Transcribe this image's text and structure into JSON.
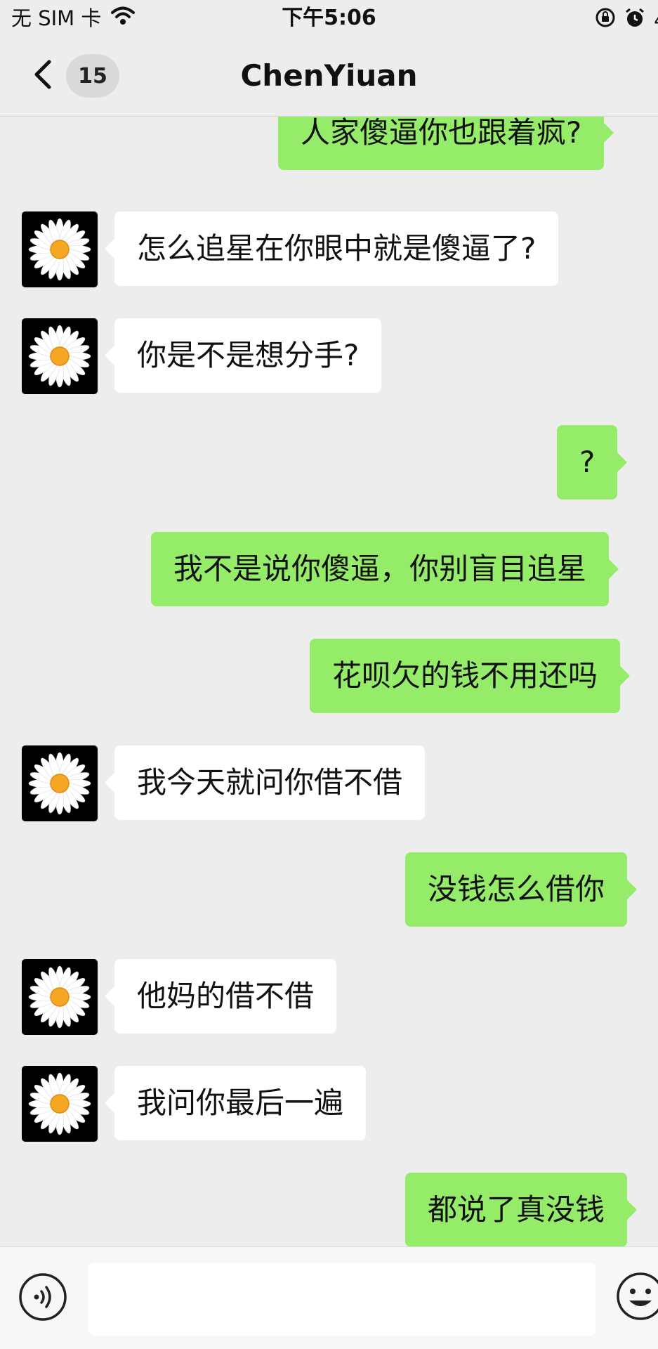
{
  "status_bar": {
    "carrier": "无 SIM 卡",
    "time": "下午5:06",
    "battery_partial": "4"
  },
  "nav": {
    "unread_count": "15",
    "title": "ChenYiuan"
  },
  "messages": [
    {
      "side": "me",
      "text": "人家傻逼你也跟着疯?"
    },
    {
      "side": "them",
      "text": "怎么追星在你眼中就是傻逼了?"
    },
    {
      "side": "them",
      "text": "你是不是想分手?"
    },
    {
      "side": "me",
      "text": "?"
    },
    {
      "side": "me",
      "text": "我不是说你傻逼，你别盲目追星"
    },
    {
      "side": "me",
      "text": "花呗欠的钱不用还吗"
    },
    {
      "side": "them",
      "text": "我今天就问你借不借"
    },
    {
      "side": "me",
      "text": "没钱怎么借你"
    },
    {
      "side": "them",
      "text": "他妈的借不借"
    },
    {
      "side": "them",
      "text": "我问你最后一遍"
    },
    {
      "side": "me",
      "text": "都说了真没钱"
    }
  ],
  "input": {
    "value": ""
  },
  "colors": {
    "background": "#ededed",
    "my_bubble": "#95ec69",
    "their_bubble": "#ffffff",
    "avatar_bg": "#000000",
    "daisy_center": "#f5a623"
  },
  "icons": {
    "back": "chevron-left-icon",
    "wifi": "wifi-icon",
    "lock_rotation": "rotation-lock-icon",
    "alarm": "alarm-icon",
    "voice": "voice-icon",
    "emoji": "emoji-icon",
    "avatar": "daisy-avatar"
  }
}
